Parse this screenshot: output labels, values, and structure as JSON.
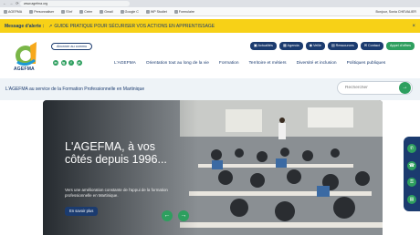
{
  "browser": {
    "url": "www.agefma.org",
    "bookmarks": [
      "AGEFMA",
      "Personnaliser",
      "S'Inf",
      "Créer",
      "Gmail",
      "Google C",
      "WP Studiet",
      "Formulaire"
    ],
    "bookmarks_right": [
      "Menu & tous",
      "Tous les favoris"
    ],
    "profile_text": "Bonjour, Sonia CHEVALIER"
  },
  "alert": {
    "label": "Message d'alerte :",
    "text": "GUIDE PRATIQUE POUR SÉCURISER VOS ACTIONS EN APPRENTISSAGE",
    "close": "×"
  },
  "logo": {
    "name": "AGEFMA"
  },
  "subscribe_label": "Abonner au commu",
  "socials": [
    "in",
    "ig",
    "f",
    "yt"
  ],
  "top_buttons": [
    {
      "label": "Actualités",
      "icon": "news-icon"
    },
    {
      "label": "Agenda",
      "icon": "calendar-icon"
    },
    {
      "label": "Veille",
      "icon": "eye-icon"
    },
    {
      "label": "Ressources",
      "icon": "folder-icon"
    },
    {
      "label": "Contact",
      "icon": "mail-icon"
    },
    {
      "label": "Appel d'offres",
      "icon": "doc-icon"
    }
  ],
  "main_nav": [
    "L'AGEFMA",
    "Orientation tout au long de la vie",
    "Formation",
    "Territoire et métiers",
    "Diversité et inclusion",
    "Politiques publiques"
  ],
  "band_title": "L'AGEFMA au service de la Formation Professionnelle en Martinique",
  "search": {
    "placeholder": "Rechercher"
  },
  "hero": {
    "title": "L'AGEFMA, à vos côtés depuis 1996...",
    "description": "Vers une amélioration constante de l'appui de la formation professionnelle en Martinique.",
    "cta": "En savoir plus"
  },
  "colors": {
    "navy": "#1b3b6f",
    "green": "#2e9f5f",
    "yellow": "#f7d117"
  }
}
